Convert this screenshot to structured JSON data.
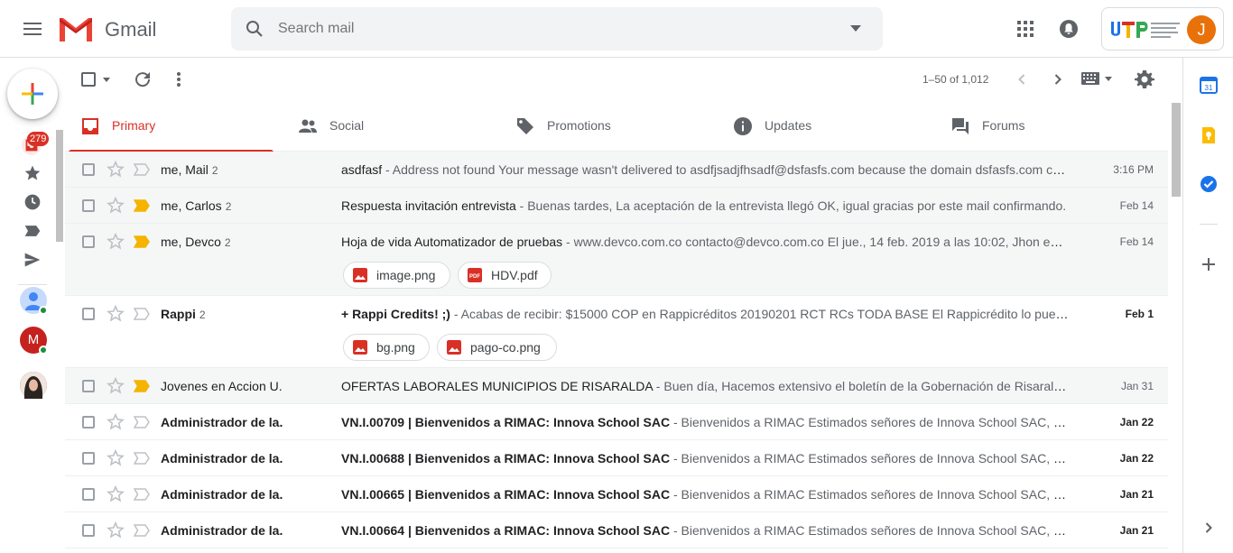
{
  "header": {
    "app_name": "Gmail",
    "search_placeholder": "Search mail",
    "avatar_letter": "J"
  },
  "left_rail": {
    "inbox_count": "279"
  },
  "toolbar": {
    "pager": "1–50 of 1,012"
  },
  "tabs": [
    {
      "label": "Primary",
      "icon": "inbox-icon",
      "active": true
    },
    {
      "label": "Social",
      "icon": "people-icon"
    },
    {
      "label": "Promotions",
      "icon": "tag-icon"
    },
    {
      "label": "Updates",
      "icon": "info-icon"
    },
    {
      "label": "Forums",
      "icon": "forum-icon"
    }
  ],
  "emails": [
    {
      "sender": "me, Mail",
      "count": "2",
      "subject": "asdfasf",
      "snippet": " - Address not found Your message wasn't delivered to asdfjsadjfhsadf@dsfasfs.com because the domain dsfasfs.com couldn't be found.",
      "date": "3:16 PM",
      "unread": false,
      "important": false
    },
    {
      "sender": "me, Carlos",
      "count": "2",
      "subject": "Respuesta invitación entrevista",
      "snippet": " - Buenas tardes, La aceptación de la entrevista llegó OK, igual gracias por este mail confirmando.",
      "date": "Feb 14",
      "unread": false,
      "important": true
    },
    {
      "sender": "me, Devco",
      "count": "2",
      "subject": "Hoja de vida Automatizador de pruebas",
      "snippet": " - www.devco.com.co contacto@devco.com.co El jue., 14 feb. 2019 a las 10:02, Jhon escribió:",
      "date": "Feb 14",
      "unread": false,
      "important": true,
      "attachments": [
        "image.png",
        "HDV.pdf"
      ]
    },
    {
      "sender": "Rappi",
      "count": "2",
      "subject": "+ Rappi Credits! ;)",
      "snippet": " - Acabas de recibir: $15000 COP en Rappicréditos 20190201 RCT RCs TODA BASE El Rappicrédito lo puedes usar",
      "date": "Feb 1",
      "unread": true,
      "important": false,
      "attachments": [
        "bg.png",
        "pago-co.png"
      ]
    },
    {
      "sender": "Jovenes en Accion U.",
      "count": "",
      "subject": "OFERTAS LABORALES MUNICIPIOS DE RISARALDA",
      "snippet": " - Buen día, Hacemos extensivo el boletín de la Gobernación de Risaralda referente",
      "date": "Jan 31",
      "unread": false,
      "important": true
    },
    {
      "sender": "Administrador de la.",
      "count": "",
      "subject": "VN.I.00709 | Bienvenidos a RIMAC: Innova School SAC",
      "snippet": " - Bienvenidos a RIMAC Estimados señores de Innova School SAC, queremos",
      "date": "Jan 22",
      "unread": true,
      "important": false
    },
    {
      "sender": "Administrador de la.",
      "count": "",
      "subject": "VN.I.00688 | Bienvenidos a RIMAC: Innova School SAC",
      "snippet": " - Bienvenidos a RIMAC Estimados señores de Innova School SAC, queremos",
      "date": "Jan 22",
      "unread": true,
      "important": false
    },
    {
      "sender": "Administrador de la.",
      "count": "",
      "subject": "VN.I.00665 | Bienvenidos a RIMAC: Innova School SAC",
      "snippet": " - Bienvenidos a RIMAC Estimados señores de Innova School SAC, queremos",
      "date": "Jan 21",
      "unread": true,
      "important": false
    },
    {
      "sender": "Administrador de la.",
      "count": "",
      "subject": "VN.I.00664 | Bienvenidos a RIMAC: Innova School SAC",
      "snippet": " - Bienvenidos a RIMAC Estimados señores de Innova School SAC, queremos",
      "date": "Jan 21",
      "unread": true,
      "important": false
    }
  ],
  "colors": {
    "accent_red": "#d93025",
    "important_yellow": "#f4b400",
    "avatar_orange": "#e8710a"
  }
}
